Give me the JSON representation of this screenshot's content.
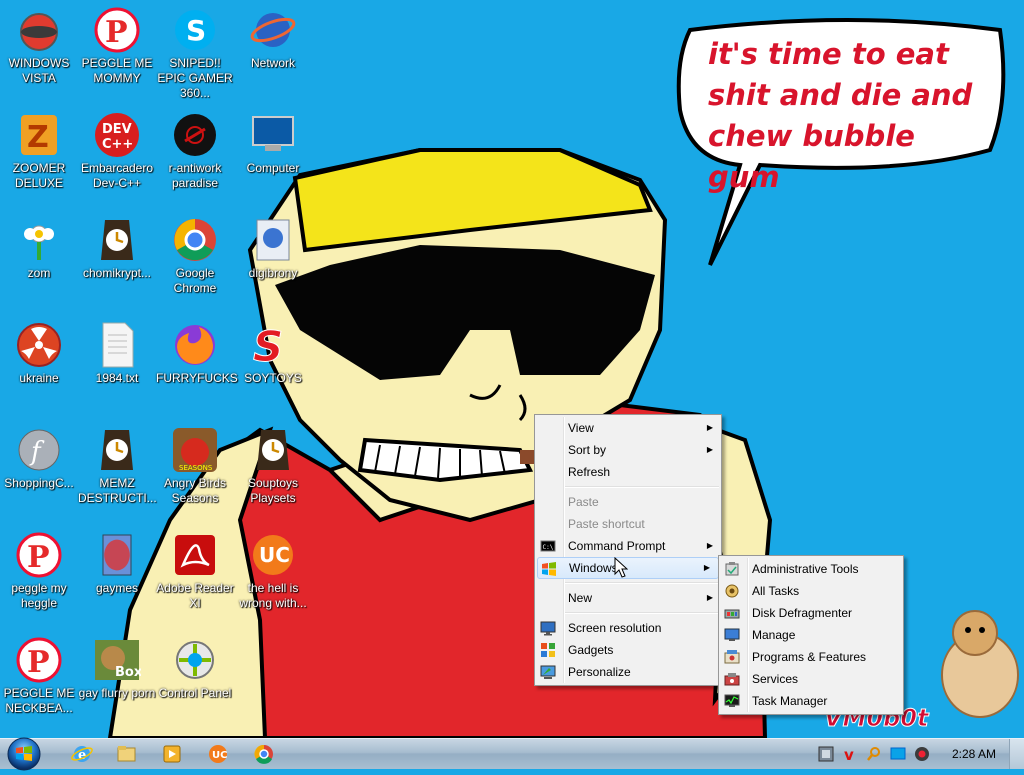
{
  "wallpaper": {
    "speech_text": "it's time to eat shit and die and chew bubble gum",
    "watermark": "VM0b0t"
  },
  "desktop_icons": [
    {
      "label": "WINDOWS VISTA",
      "icon": "windows-vista-icon"
    },
    {
      "label": "PEGGLE ME MOMMY",
      "icon": "peggle-icon"
    },
    {
      "label": "SNIPED!! EPIC GAMER 360...",
      "icon": "skype-icon"
    },
    {
      "label": "Network",
      "icon": "network-icon"
    },
    {
      "label": "ZOOMER DELUXE",
      "icon": "zoomer-icon"
    },
    {
      "label": "Embarcadero Dev-C++",
      "icon": "devcpp-icon"
    },
    {
      "label": "r-antiwork paradise",
      "icon": "antiwork-icon"
    },
    {
      "label": "Computer",
      "icon": "computer-icon"
    },
    {
      "label": "zom",
      "icon": "flower-icon"
    },
    {
      "label": "chomikrypt...",
      "icon": "clock-app-icon"
    },
    {
      "label": "Google Chrome",
      "icon": "chrome-icon"
    },
    {
      "label": "digibrony",
      "icon": "digibrony-icon"
    },
    {
      "label": "ukraine",
      "icon": "radiation-icon"
    },
    {
      "label": "1984.txt",
      "icon": "text-file-icon"
    },
    {
      "label": "FURRYFUCKS",
      "icon": "firefox-icon"
    },
    {
      "label": "SOYTOYS",
      "icon": "soytoys-icon"
    },
    {
      "label": "ShoppingC...",
      "icon": "flash-icon"
    },
    {
      "label": "MEMZ DESTRUCTI...",
      "icon": "clock-app-icon"
    },
    {
      "label": "Angry Birds Seasons",
      "icon": "angry-birds-icon"
    },
    {
      "label": "Souptoys Playsets",
      "icon": "clock-app-icon"
    },
    {
      "label": "peggle my heggle",
      "icon": "peggle-icon"
    },
    {
      "label": "gaymes",
      "icon": "games-folder-icon"
    },
    {
      "label": "Adobe Reader XI",
      "icon": "adobe-reader-icon"
    },
    {
      "label": "the hell is wrong with...",
      "icon": "uc-browser-icon"
    },
    {
      "label": "PEGGLE ME NECKBEA...",
      "icon": "peggle-icon"
    },
    {
      "label": "gay flurry porn",
      "icon": "box-icon"
    },
    {
      "label": "Control Panel",
      "icon": "control-panel-icon"
    }
  ],
  "context_menu": {
    "items": [
      {
        "label": "View",
        "submenu": true
      },
      {
        "label": "Sort by",
        "submenu": true
      },
      {
        "label": "Refresh"
      },
      {
        "label": "Paste",
        "disabled": true
      },
      {
        "label": "Paste shortcut",
        "disabled": true
      },
      {
        "label": "Command Prompt",
        "submenu": true,
        "icon": "cmd-icon"
      },
      {
        "label": "Windows",
        "submenu": true,
        "icon": "windows-flag-icon",
        "highlighted": true
      },
      {
        "label": "New",
        "submenu": true
      },
      {
        "label": "Screen resolution",
        "icon": "display-icon"
      },
      {
        "label": "Gadgets",
        "icon": "gadgets-icon"
      },
      {
        "label": "Personalize",
        "icon": "personalize-icon"
      }
    ]
  },
  "submenu": {
    "items": [
      {
        "label": "Administrative Tools",
        "icon": "admin-tools-icon"
      },
      {
        "label": "All Tasks",
        "icon": "all-tasks-icon"
      },
      {
        "label": "Disk Defragmenter",
        "icon": "defrag-icon"
      },
      {
        "label": "Manage",
        "icon": "manage-icon"
      },
      {
        "label": "Programs & Features",
        "icon": "programs-icon"
      },
      {
        "label": "Services",
        "icon": "services-icon"
      },
      {
        "label": "Task Manager",
        "icon": "task-manager-icon"
      }
    ]
  },
  "taskbar": {
    "pinned": [
      "internet-explorer-icon",
      "explorer-folder-icon",
      "media-player-icon",
      "uc-browser-icon",
      "chrome-icon"
    ],
    "tray": [
      "network-tray-icon",
      "antivirus-tray-icon",
      "search-tray-icon",
      "display-tray-icon",
      "volume-tray-icon"
    ],
    "clock": "2:28 AM"
  },
  "colors": {
    "desktop": "#19a8e6",
    "speech": "#d8142c",
    "shirt": "#e2262b",
    "bandana": "#f4e41a",
    "skin": "#f9f0b4"
  }
}
